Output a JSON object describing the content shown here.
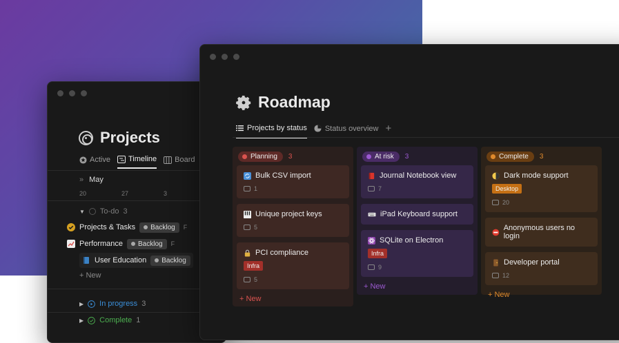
{
  "back_window": {
    "title": "Projects",
    "tabs": [
      {
        "label": "Active",
        "icon": "star-icon"
      },
      {
        "label": "Timeline",
        "icon": "timeline-icon"
      },
      {
        "label": "Board",
        "icon": "board-icon"
      }
    ],
    "timeline": {
      "month": "May",
      "days": [
        "20",
        "27",
        "3"
      ]
    },
    "groups": {
      "todo": {
        "label": "To-do",
        "count": "3"
      },
      "in_progress": {
        "label": "In progress",
        "count": "3"
      },
      "complete": {
        "label": "Complete",
        "count": "1"
      }
    },
    "rows": [
      {
        "label": "Projects & Tasks",
        "badge": "Backlog",
        "letter": "F"
      },
      {
        "label": "Performance",
        "badge": "Backlog",
        "letter": "F"
      },
      {
        "label": "User Education",
        "badge": "Backlog"
      }
    ],
    "new_label": "New"
  },
  "front_window": {
    "title": "Roadmap",
    "tabs": [
      {
        "label": "Projects by status",
        "icon": "list-icon"
      },
      {
        "label": "Status overview",
        "icon": "pie-icon"
      }
    ],
    "columns": [
      {
        "label": "Planning",
        "count": "3",
        "accent": "#d9534f",
        "bg": "#2a1f1d",
        "pill": "#5e2a27",
        "card": "#3e2823",
        "cards": [
          {
            "title": "Bulk CSV import",
            "comments": "1"
          },
          {
            "title": "Unique project keys",
            "comments": "5"
          },
          {
            "title": "PCI compliance",
            "tag": "Infra",
            "comments": "5"
          }
        ]
      },
      {
        "label": "At risk",
        "count": "3",
        "accent": "#9b59d0",
        "bg": "#241d2c",
        "pill": "#4a2c66",
        "card": "#352748",
        "cards": [
          {
            "title": "Journal Notebook view",
            "comments": "7"
          },
          {
            "title": "iPad Keyboard support"
          },
          {
            "title": "SQLite on Electron",
            "tag": "Infra",
            "comments": "9"
          }
        ]
      },
      {
        "label": "Complete",
        "count": "3",
        "accent": "#e08a2c",
        "bg": "#2c2219",
        "pill": "#6a3e12",
        "card": "#3f2d1e",
        "cards": [
          {
            "title": "Dark mode support",
            "tag": "Desktop",
            "comments": "20"
          },
          {
            "title": "Anonymous users no login"
          },
          {
            "title": "Developer portal",
            "comments": "12"
          }
        ]
      }
    ],
    "new_label": "New"
  }
}
